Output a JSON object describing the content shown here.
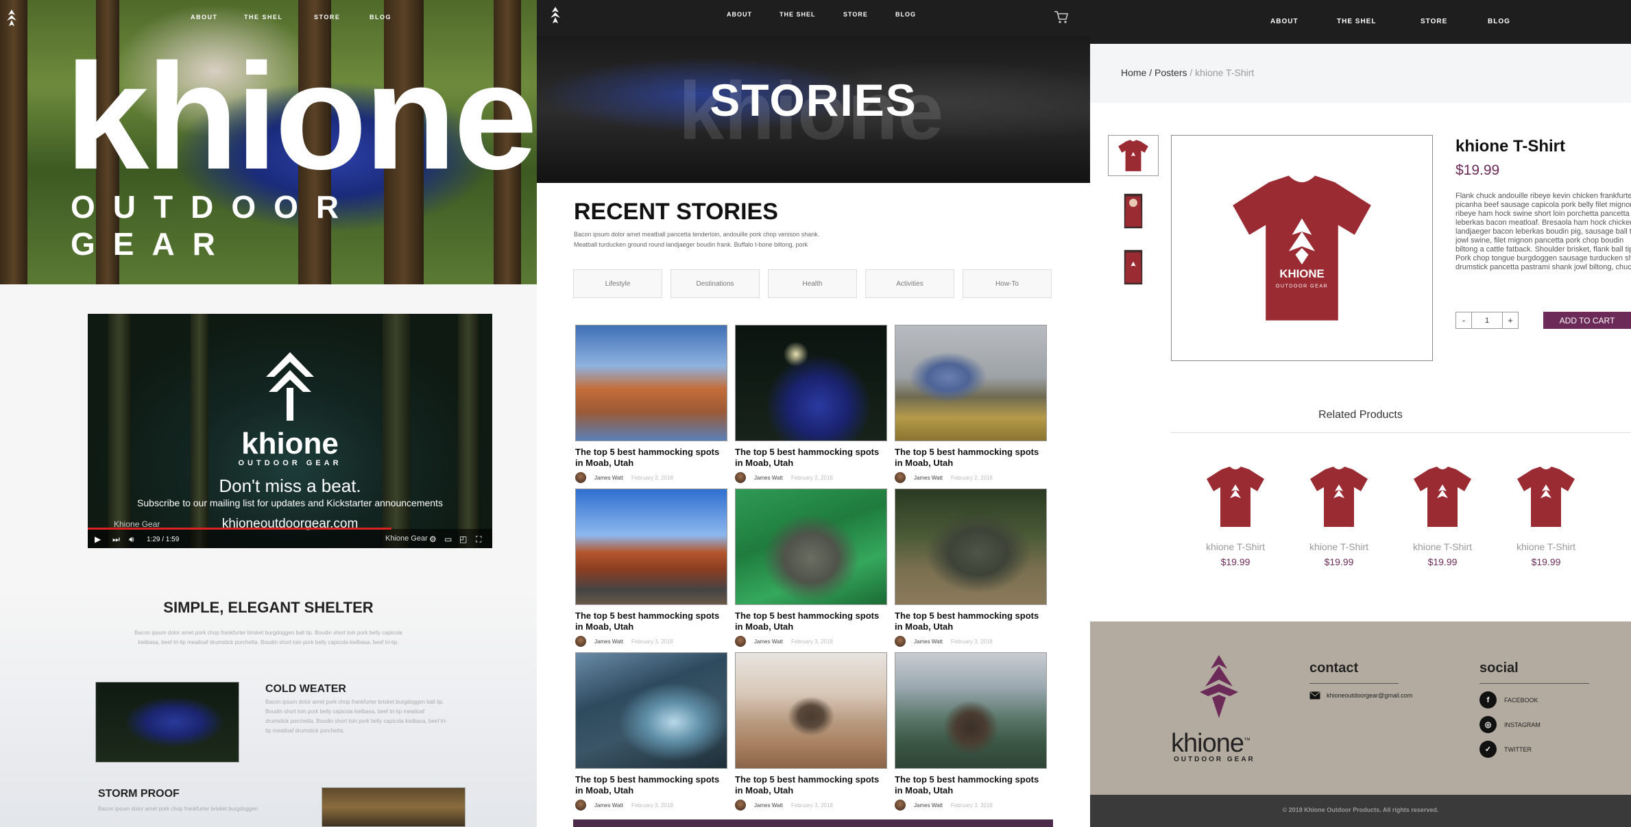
{
  "home": {
    "nav": [
      "ABOUT",
      "THE SHEL",
      "STORE",
      "BLOG"
    ],
    "hero_title": "khione",
    "hero_subtitle": "OUTDOOR GEAR",
    "video": {
      "brand": "khione",
      "brand_sub": "OUTDOOR GEAR",
      "headline": "Don't miss a beat.",
      "subline": "Subscribe to our mailing list for updates and Kickstarter announcements",
      "url": "khioneoutdoorgear.com",
      "channel": "Khione Gear",
      "time": "1:29 / 1:59",
      "watermark": "Khione Gear",
      "progress": 0.75
    },
    "section_title": "SIMPLE, ELEGANT SHELTER",
    "section_text": [
      "Bacon ipsum dolor amet pork chop frankfurter brisket burgdoggen ball tip. Boudin short loin pork belly capicola",
      "kielbasa, beef tri-tip meatloaf drumstick porchetta. Boudin short loin pork belly capicola kielbasa, beef tri-tip."
    ],
    "cold_title": "COLD WEATER",
    "cold_text": [
      "Bacon ipsum dolor amet pork chop frankfurter brisket burgdoggen ball tip.",
      "Boudin short loin pork belly capicola kielbasa, beef tri-tip meatloaf",
      "drumstick porchetta. Boudin short loin pork belly capicola kielbasa, beef tri-",
      "tip meatloaf drumstick porchetta."
    ],
    "storm_title": "STORM PROOF",
    "storm_text": "Bacon ipsum dolor amet pork chop frankfurter brisket burgdoggen"
  },
  "stories": {
    "nav": [
      "ABOUT",
      "THE SHEL",
      "STORE",
      "BLOG"
    ],
    "banner_ghost": "khione",
    "banner_title": "STORIES",
    "recent_title": "RECENT STORIES",
    "intro": [
      "Bacon ipsum dolor amet meatball pancetta tenderloin, andouille pork chop venison shank.",
      "Meatball turducken ground round landjaeger boudin frank. Buffalo t-bone biltong, pork"
    ],
    "categories": [
      "Lifestyle",
      "Destinations",
      "Health",
      "Activities",
      "How-To"
    ],
    "cards": [
      {
        "title1": "The top 5 best hammocking spots",
        "title2": "in Moab, Utah",
        "author": "James Watt",
        "date": "February 2, 2018"
      },
      {
        "title1": "The top 5 best hammocking spots",
        "title2": "in Moab, Utah",
        "author": "James Watt",
        "date": "February 2, 2018"
      },
      {
        "title1": "The top 5 best hammocking spots",
        "title2": "in Moab, Utah",
        "author": "James Watt",
        "date": "February 2, 2018"
      },
      {
        "title1": "The top 5 best hammocking spots",
        "title2": "in Moab, Utah",
        "author": "James Watt",
        "date": "February 3, 2018"
      },
      {
        "title1": "The top 5 best hammocking spots",
        "title2": "in Moab, Utah",
        "author": "James Watt",
        "date": "February 3, 2018"
      },
      {
        "title1": "The top 5 best hammocking spots",
        "title2": "in Moab, Utah",
        "author": "James Watt",
        "date": "February 3, 2018"
      },
      {
        "title1": "The top 5 best hammocking spots",
        "title2": "in Moab, Utah",
        "author": "James Watt",
        "date": "February 3, 2018"
      },
      {
        "title1": "The top 5 best hammocking spots",
        "title2": "in Moab, Utah",
        "author": "James Watt",
        "date": "February 3, 2018"
      },
      {
        "title1": "The top 5 best hammocking spots",
        "title2": "in Moab, Utah",
        "author": "James Watt",
        "date": "February 3, 2018"
      }
    ]
  },
  "product": {
    "nav": [
      "ABOUT",
      "THE SHEL",
      "STORE",
      "BLOG"
    ],
    "breadcrumb_home": "Home",
    "breadcrumb_sep1": " / ",
    "breadcrumb_posters": "Posters",
    "breadcrumb_current": " / khione T-Shirt",
    "title": "khione T-Shirt",
    "price": "$19.99",
    "description": [
      "Flank chuck andouille ribeye kevin chicken frankfurter",
      "picanha beef sausage capicola pork belly filet mignon",
      "ribeye ham hock swine short loin porchetta pancetta",
      "leberkas bacon meatloaf. Bresaola ham hock chicken",
      "landjaeger bacon leberkas boudin pig, sausage ball tip",
      "jowl swine, filet mignon pancetta pork chop boudin",
      "biltong a cattle fatback. Shoulder brisket, flank ball tip",
      "Pork chop tongue burgdoggen sausage turducken short",
      "drumstick pancetta pastrami shank jowl biltong, chuck"
    ],
    "qty_minus": "-",
    "quantity": "1",
    "qty_plus": "+",
    "add_to_cart": "ADD TO CART",
    "shirt_brand": "KHIONE",
    "shirt_sub": "OUTDOOR GEAR",
    "related_title": "Related Products",
    "related": [
      {
        "name": "khione T-Shirt",
        "price": "$19.99"
      },
      {
        "name": "khione T-Shirt",
        "price": "$19.99"
      },
      {
        "name": "khione T-Shirt",
        "price": "$19.99"
      },
      {
        "name": "khione T-Shirt",
        "price": "$19.99"
      }
    ],
    "footer": {
      "brand": "khione",
      "brand_tm": "™",
      "brand_sub": "OUTDOOR GEAR",
      "contact_head": "contact",
      "email": "khioneoutdoorgear@gmail.com",
      "social_head": "social",
      "social": [
        "FACEBOOK",
        "INSTAGRAM",
        "TWITTER"
      ],
      "copyright": "© 2018 Khione Outdoor Products. All rights reserved."
    }
  },
  "colors": {
    "accent": "#6b2a57",
    "shirt": "#9b2b33",
    "nav": "#1e1e1e",
    "footer": "#b3aba0"
  }
}
